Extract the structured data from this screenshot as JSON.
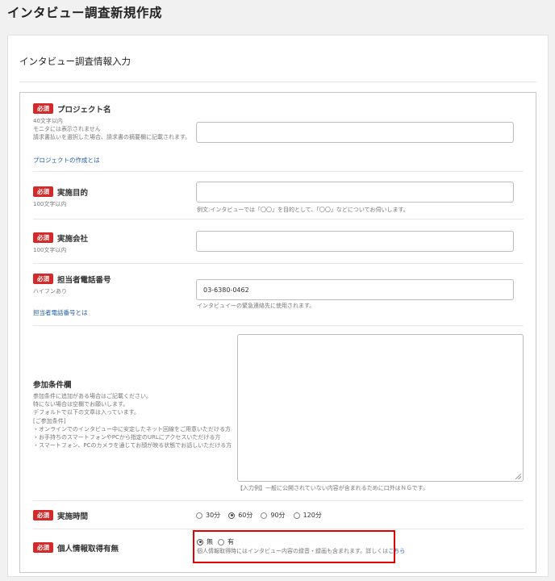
{
  "page": {
    "title": "インタビュー調査新規作成"
  },
  "card": {
    "title": "インタビュー調査情報入力"
  },
  "required_label": "必須",
  "fields": {
    "project_name": {
      "label": "プロジェクト名",
      "hints": [
        "40文字以内",
        "モニタには表示されません",
        "請求書払いを選択した場合、請求書の摘要欄に記載されます。"
      ],
      "link": "プロジェクトの作成とは",
      "value": "",
      "placeholder": ""
    },
    "purpose": {
      "label": "実施目的",
      "hint": "100文字以内",
      "value": "",
      "note": "例文:インタビューでは「〇〇」を目的として、「〇〇」などについてお伺いします。"
    },
    "company": {
      "label": "実施会社",
      "hint": "100文字以内",
      "value": ""
    },
    "phone": {
      "label": "担当者電話番号",
      "hint": "ハイフンあり",
      "link": "担当者電話番号とは",
      "value": "03-6380-0462",
      "note": "インタビュイーの緊急連絡先に使用されます。"
    },
    "conditions": {
      "label": "参加条件欄",
      "hints": [
        "参加条件に追加がある場合はご記載ください。",
        "特にない場合は空欄でお願いします。",
        "デフォルトで以下の文章は入っています。",
        "[ご参加条件]",
        "・オンラインでのインタビュー中に安定したネット回線をご用意いただける方",
        "・お手持ちのスマートフォンやPCから指定のURLにアクセスいただける方",
        "・スマートフォン、PCのカメラを通じてお顔が映る状態でお話しいただける方"
      ],
      "value": "",
      "note": "【入力例】一般に公開されていない内容が含まれるために口外はＮＧです。"
    },
    "duration": {
      "label": "実施時間",
      "options": [
        "30分",
        "60分",
        "90分",
        "120分"
      ],
      "selected": "60分"
    },
    "privacy": {
      "label": "個人情報取得有無",
      "options": [
        "無",
        "有"
      ],
      "selected": "無",
      "note": "個人情報取得時にはインタビュー内容の録音・録画も含まれます。詳しくは",
      "note_link": "こちら"
    }
  }
}
